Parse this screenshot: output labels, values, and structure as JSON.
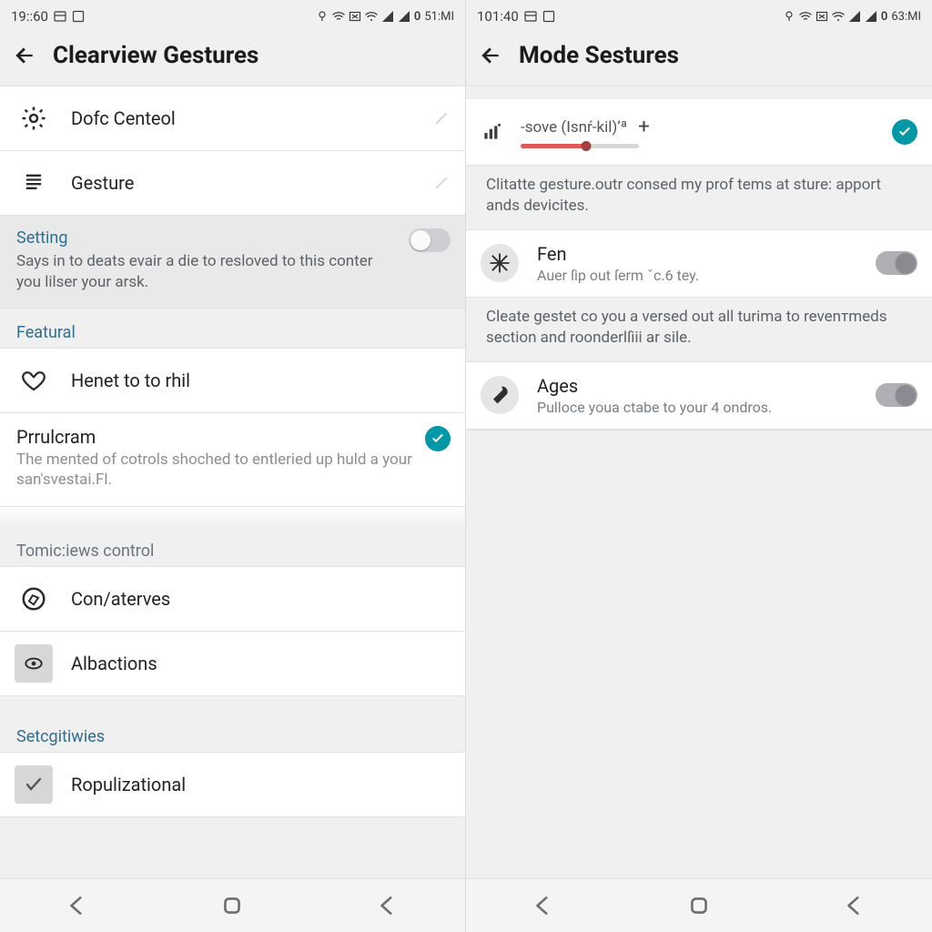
{
  "left": {
    "status": {
      "time": "19::60",
      "right_text": "51:MI"
    },
    "title": "Clearview Gestures",
    "rows": {
      "dof": "Dofc Centeol",
      "gesture": "Gesture"
    },
    "setting_block": {
      "header": "Setting",
      "sub": "Says in to deats evair a die to resloved to this conter you lilser your arsk."
    },
    "featural_header": "Featural",
    "featural_item": "Henet to to rhil",
    "prulcram": {
      "title": "Prrulcram",
      "sub": "The mented of cotrols shoched to entleried up huld a your san'svestai.Fl."
    },
    "tomic_header": "Tomic:iews control",
    "tomic_items": {
      "con": "Con/aterves",
      "alb": "Albactions"
    },
    "setg_header": "Setcgitiwies",
    "setg_item": "Ropulizational"
  },
  "right": {
    "status": {
      "time": "101:40",
      "right_text": "63:MI"
    },
    "title": "Mode Sestures",
    "sove_label": "-sove (Isnŕ-kil)’ª",
    "note1": "Clitatte gesture.outr consed my prof tems at sture: apport ands devicites.",
    "fen": {
      "title": "Fen",
      "sub": "Auer ſip out ſerm ˇc.6 tey."
    },
    "note2": "Cleate gestet co you a versed out all turima to revenтmeds section and roonderlſiii ar sile.",
    "ages": {
      "title": "Ages",
      "sub": "Pulloce youa ctabe to your 4 ondros."
    }
  },
  "icons": {
    "battery_glyph": "0"
  }
}
